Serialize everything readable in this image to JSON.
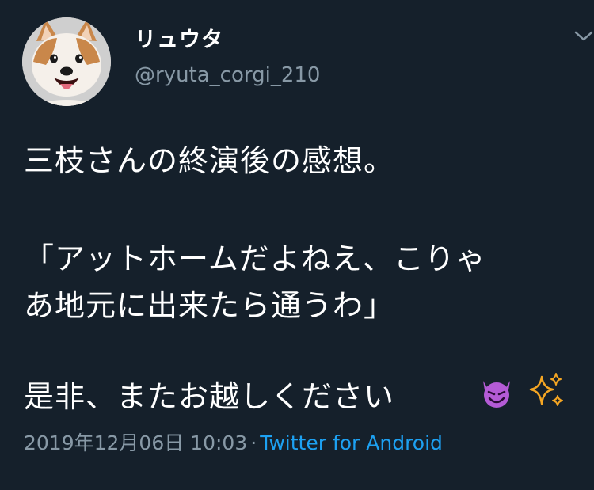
{
  "author": {
    "display_name": "リュウタ",
    "handle": "@ryuta_corgi_210",
    "avatar_icon": "corgi-avatar"
  },
  "tweet": {
    "lines": [
      "三枝さんの終演後の感想。",
      "「アットホームだよねえ、こりゃ",
      "あ地元に出来たら通うわ」",
      "是非、またお越しください"
    ],
    "emojis": [
      "devil-smile-emoji",
      "sparkles-emoji"
    ]
  },
  "meta": {
    "timestamp": "2019年12月06日 10:03",
    "separator": "·",
    "source": "Twitter for Android"
  },
  "colors": {
    "background": "#15202b",
    "secondary_text": "#8899a6",
    "link": "#1da1f2"
  }
}
